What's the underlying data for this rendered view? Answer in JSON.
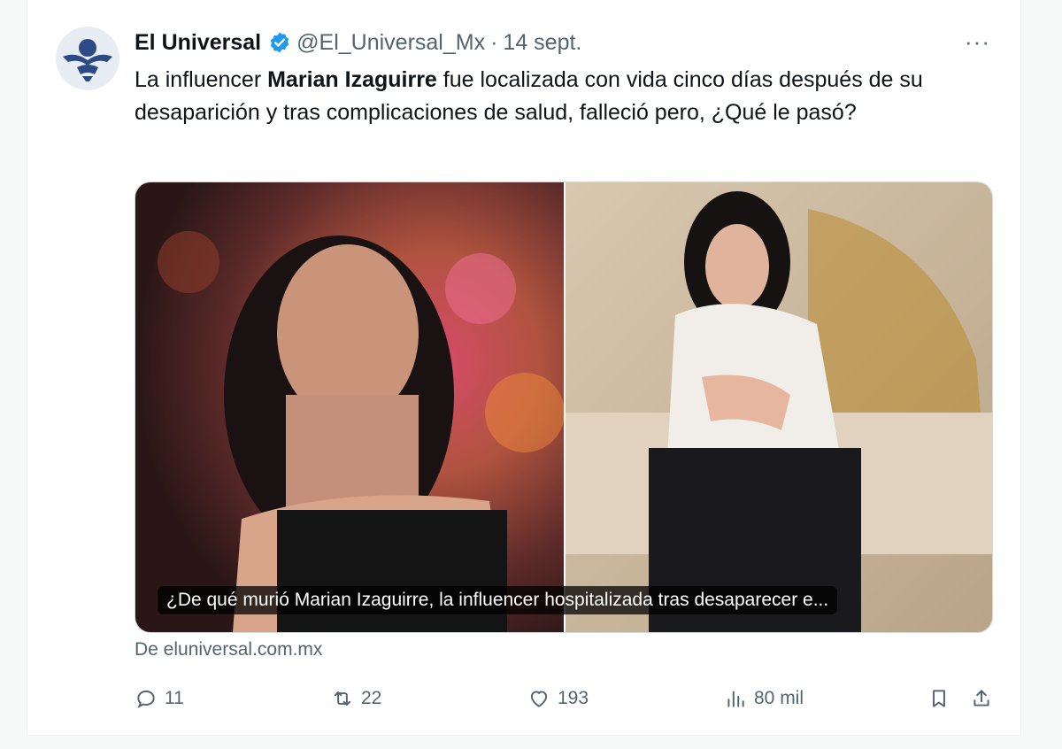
{
  "tweet": {
    "author_name": "El Universal",
    "handle": "@El_Universal_Mx",
    "separator": "·",
    "date": "14 sept.",
    "more_label": "···",
    "text_before": "La influencer ",
    "text_bold": "Marian Izaguirre",
    "text_after": " fue localizada con vida cinco días después de su desaparición y tras complicaciones de salud, falleció pero, ¿Qué le pasó?",
    "card": {
      "caption": "¿De qué murió Marian Izaguirre, la influencer hospitalizada tras desaparecer e..."
    },
    "source": "De eluniversal.com.mx",
    "actions": {
      "replies": "11",
      "retweets": "22",
      "likes": "193",
      "views": "80 mil"
    }
  },
  "colors": {
    "verified": "#1d9bf0",
    "secondary_text": "#536471",
    "primary_text": "#0f1419"
  }
}
